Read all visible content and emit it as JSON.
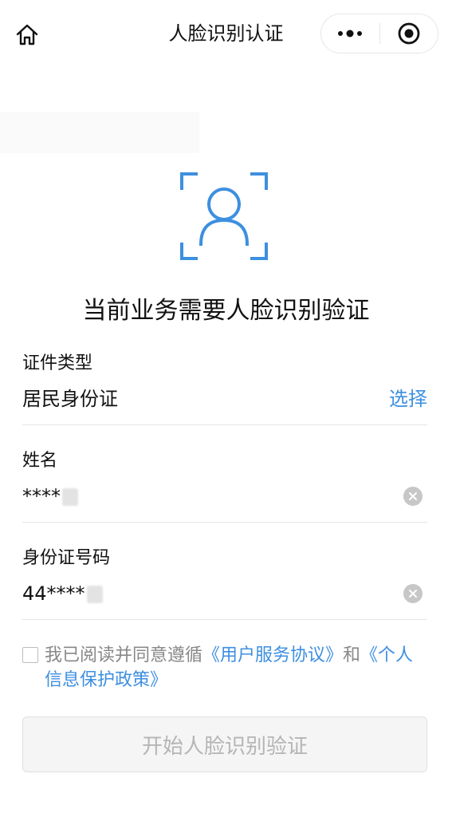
{
  "header": {
    "title": "人脸识别认证",
    "home_icon": "home-icon",
    "more_icon": "more-dots-icon",
    "close_icon": "target-close-icon"
  },
  "main": {
    "face_icon": "face-scan-icon",
    "headline": "当前业务需要人脸识别验证",
    "accent_color": "#3d8fe0"
  },
  "form": {
    "id_type": {
      "label": "证件类型",
      "value": "居民身份证",
      "action_label": "选择"
    },
    "name": {
      "label": "姓名",
      "value": "****"
    },
    "id_number": {
      "label": "身份证号码",
      "value": "44****"
    }
  },
  "agreement": {
    "prefix": "我已阅读并同意遵循",
    "user_agreement": "《用户服务协议》",
    "conjunction": "和",
    "privacy_policy": "《个人信息保护政策》",
    "checked": false
  },
  "submit": {
    "label": "开始人脸识别验证",
    "enabled": false
  }
}
